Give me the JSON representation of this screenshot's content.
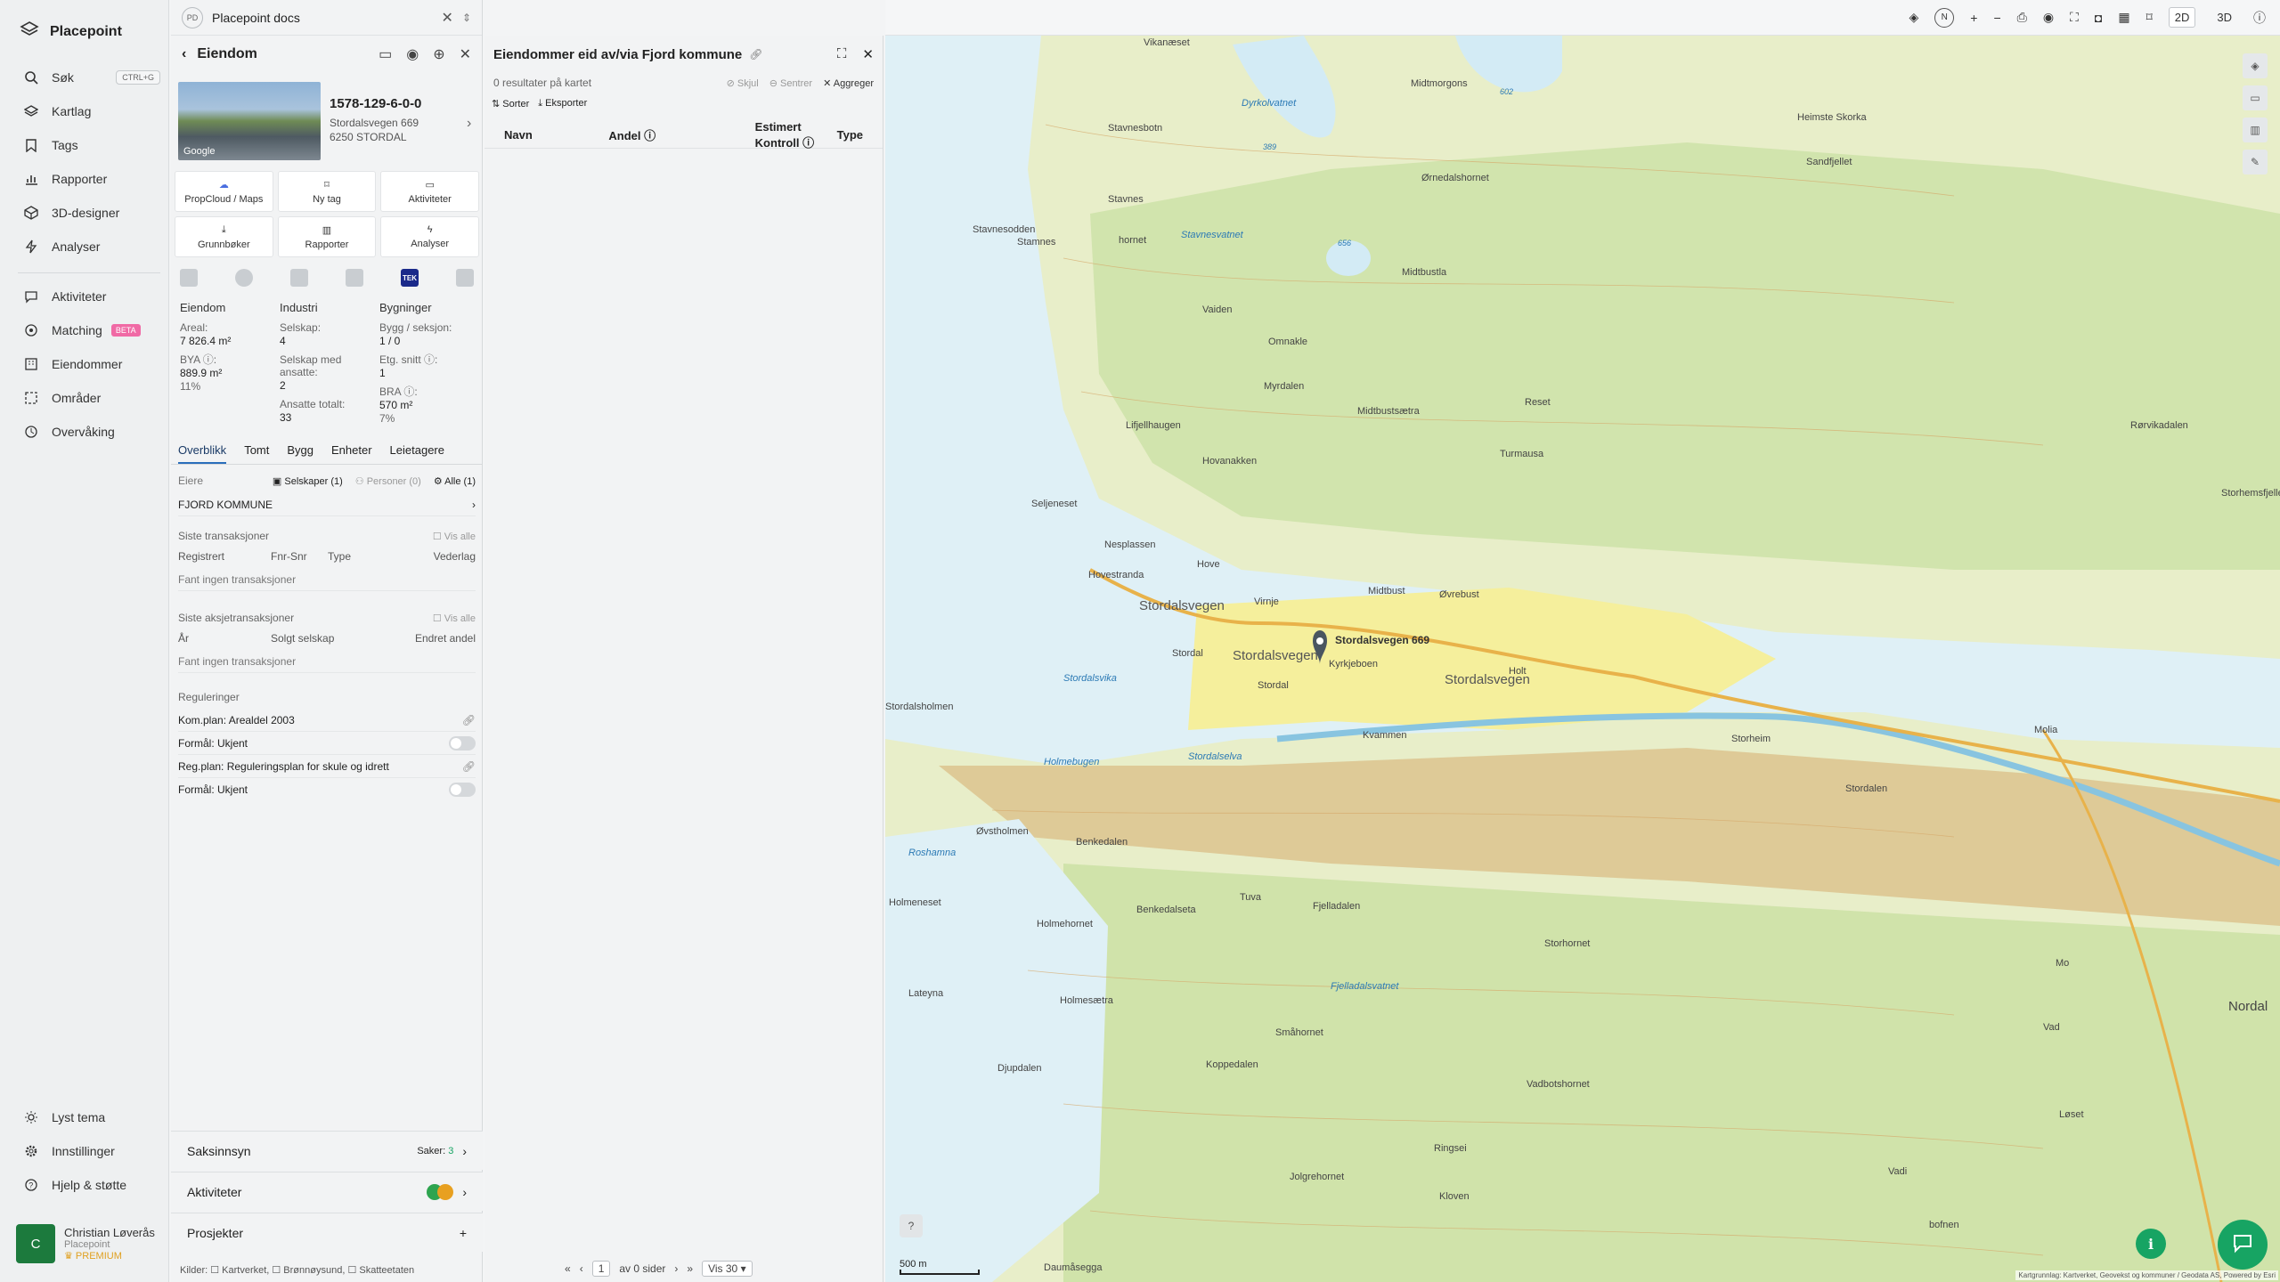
{
  "sidebar": {
    "brand": "Placepoint",
    "items": [
      {
        "label": "Søk",
        "icon": "search-icon",
        "kbd": "CTRL+G"
      },
      {
        "label": "Kartlag",
        "icon": "layers-icon"
      },
      {
        "label": "Tags",
        "icon": "bookmark-icon"
      },
      {
        "label": "Rapporter",
        "icon": "report-icon"
      },
      {
        "label": "3D-designer",
        "icon": "cube-icon"
      },
      {
        "label": "Analyser",
        "icon": "bolt-icon"
      },
      {
        "label": "Aktiviteter",
        "icon": "chat-icon"
      },
      {
        "label": "Matching",
        "icon": "target-icon",
        "badge": "BETA"
      },
      {
        "label": "Eiendommer",
        "icon": "building-icon"
      },
      {
        "label": "Områder",
        "icon": "area-icon"
      },
      {
        "label": "Overvåking",
        "icon": "monitor-icon"
      }
    ],
    "bottom": [
      {
        "label": "Lyst tema",
        "icon": "sun-icon"
      },
      {
        "label": "Innstillinger",
        "icon": "gear-icon"
      },
      {
        "label": "Hjelp & støtte",
        "icon": "help-icon"
      }
    ],
    "user": {
      "initial": "C",
      "name": "Christian Løverås",
      "org": "Placepoint",
      "tier": "PREMIUM"
    }
  },
  "property": {
    "workspace_badge": "PD",
    "workspace": "Placepoint docs",
    "header": "Eiendom",
    "id": "1578-129-6-0-0",
    "address1": "Stordalsvegen 669",
    "address2": "6250 STORDAL",
    "photo_credit": "Google",
    "buttons": [
      "PropCloud / Maps",
      "Ny tag",
      "Aktiviteter",
      "Grunnbøker",
      "Rapporter",
      "Analyser"
    ],
    "tek_logo": "TEK",
    "stats": {
      "eiendom": {
        "title": "Eiendom",
        "areal_label": "Areal:",
        "areal": "7 826.4 m²",
        "bya_label": "BYA ⓘ:",
        "bya": "889.9 m²",
        "bya_pct": "11%"
      },
      "industri": {
        "title": "Industri",
        "selskap_label": "Selskap:",
        "selskap": "4",
        "ansatte_label": "Selskap med ansatte:",
        "ansatte": "2",
        "total_label": "Ansatte totalt:",
        "total": "33"
      },
      "bygninger": {
        "title": "Bygninger",
        "bygg_label": "Bygg / seksjon:",
        "bygg": "1 / 0",
        "etg_label": "Etg. snitt ⓘ:",
        "etg": "1",
        "bra_label": "BRA ⓘ:",
        "bra": "570 m²",
        "bra_pct": "7%"
      }
    },
    "tabs": [
      "Overblikk",
      "Tomt",
      "Bygg",
      "Enheter",
      "Leietagere"
    ],
    "owners": {
      "label": "Eiere",
      "companies": "Selskaper (1)",
      "persons": "Personer (0)",
      "all": "Alle (1)",
      "owner": "FJORD KOMMUNE"
    },
    "transactions": {
      "title": "Siste transaksjoner",
      "show_all": "Vis alle",
      "cols": [
        "Registrert",
        "Fnr-Snr",
        "Type",
        "Vederlag"
      ],
      "empty": "Fant ingen transaksjoner"
    },
    "share_transactions": {
      "title": "Siste aksjetransaksjoner",
      "show_all": "Vis alle",
      "cols": [
        "År",
        "Solgt selskap",
        "Endret andel"
      ],
      "empty": "Fant ingen transaksjoner"
    },
    "regulations": {
      "title": "Reguleringer",
      "plan1": "Kom.plan: Arealdel 2003",
      "purpose1": "Formål: Ukjent",
      "plan2": "Reg.plan: Reguleringsplan for skule og idrett",
      "purpose2": "Formål: Ukjent"
    },
    "accordions": {
      "cases": "Saksinnsyn",
      "cases_count_label": "Saker:",
      "cases_count": "3",
      "activities": "Aktiviteter",
      "projects": "Prosjekter"
    },
    "sources": "Kilder:  ☐ Kartverket, ☐ Brønnøysund, ☐ Skatteetaten"
  },
  "list": {
    "title": "Eiendommer eid av/via Fjord kommune",
    "results": "0 resultater på kartet",
    "hide": "Skjul",
    "center": "Sentrer",
    "aggregate": "Aggreger",
    "sort": "Sorter",
    "export": "Eksporter",
    "columns": [
      "Navn",
      "Andel ⓘ",
      "Estimert Kontroll ⓘ",
      "Type"
    ],
    "pager": {
      "page": "1",
      "of": "av 0 sider",
      "show": "Vis 30"
    }
  },
  "map": {
    "modes": [
      "2D",
      "3D"
    ],
    "scale": "500 m",
    "attribution": "Kartgrunnlag: Kartverket, Geovekst og kommuner / Geodata AS, Powered by Esri",
    "pin_label": "Stordalsvegen 669",
    "labels": [
      {
        "t": "Stordalsvegen",
        "k": "road"
      },
      {
        "t": "Stordalsvegen",
        "k": "road"
      },
      {
        "t": "Stordalsvegen",
        "k": "road"
      },
      {
        "t": "Stordalsvika",
        "k": "water"
      },
      {
        "t": "Holmebugen",
        "k": "water"
      },
      {
        "t": "Roshamna",
        "k": "water"
      },
      {
        "t": "Stordalselva",
        "k": "water"
      },
      {
        "t": "Dyrkolvatnet",
        "k": "water"
      },
      {
        "t": "Stavnesvatnet",
        "k": "water"
      },
      {
        "t": "Fjelladalsvatnet",
        "k": "water"
      },
      {
        "t": "Stordal",
        "k": "place"
      },
      {
        "t": "Stordal",
        "k": "place"
      },
      {
        "t": "Kyrkjeboen",
        "k": "place"
      },
      {
        "t": "Kvammen",
        "k": "place"
      },
      {
        "t": "Holt",
        "k": "place"
      },
      {
        "t": "Storheim",
        "k": "place"
      },
      {
        "t": "Vikanæset",
        "k": "place"
      },
      {
        "t": "Stavnesbotn",
        "k": "place"
      },
      {
        "t": "Stavnes",
        "k": "place"
      },
      {
        "t": "hornet",
        "k": "place"
      },
      {
        "t": "Stavnesodden",
        "k": "place"
      },
      {
        "t": "Stamnes",
        "k": "place"
      },
      {
        "t": "Vaiden",
        "k": "place"
      },
      {
        "t": "Omnakle",
        "k": "place"
      },
      {
        "t": "Myrdalen",
        "k": "place"
      },
      {
        "t": "Lifjellhaugen",
        "k": "place"
      },
      {
        "t": "Hovanakken",
        "k": "place"
      },
      {
        "t": "Seljeneset",
        "k": "place"
      },
      {
        "t": "Nesplassen",
        "k": "place"
      },
      {
        "t": "Hovestranda",
        "k": "place"
      },
      {
        "t": "Hove",
        "k": "place"
      },
      {
        "t": "Virnje",
        "k": "place"
      },
      {
        "t": "Midtbust",
        "k": "place"
      },
      {
        "t": "Øvrebust",
        "k": "place"
      },
      {
        "t": "Midtbustsætra",
        "k": "place"
      },
      {
        "t": "Reset",
        "k": "place"
      },
      {
        "t": "Turmausa",
        "k": "place"
      },
      {
        "t": "Midtmorgons",
        "k": "place"
      },
      {
        "t": "Ørnedalshornet",
        "k": "place"
      },
      {
        "t": "Midtbustla",
        "k": "place"
      },
      {
        "t": "Heimste Skorka",
        "k": "place"
      },
      {
        "t": "Sandfjellet",
        "k": "place"
      },
      {
        "t": "Stordalsholmen",
        "k": "place"
      },
      {
        "t": "Øvstholmen",
        "k": "place"
      },
      {
        "t": "Benkedalen",
        "k": "place"
      },
      {
        "t": "Holmeneset",
        "k": "place"
      },
      {
        "t": "Holmehornet",
        "k": "place"
      },
      {
        "t": "Benkedalseta",
        "k": "place"
      },
      {
        "t": "Tuva",
        "k": "place"
      },
      {
        "t": "Fjelladalen",
        "k": "place"
      },
      {
        "t": "Lateyna",
        "k": "place"
      },
      {
        "t": "Holmesætra",
        "k": "place"
      },
      {
        "t": "Djupdalen",
        "k": "place"
      },
      {
        "t": "Koppedalen",
        "k": "place"
      },
      {
        "t": "Småhornet",
        "k": "place"
      },
      {
        "t": "Storhornet",
        "k": "place"
      },
      {
        "t": "Vadbotshornet",
        "k": "place"
      },
      {
        "t": "Ringsei",
        "k": "place"
      },
      {
        "t": "Jolgrehornet",
        "k": "place"
      },
      {
        "t": "Kloven",
        "k": "place"
      },
      {
        "t": "Daumåsegga",
        "k": "place"
      },
      {
        "t": "Mo",
        "k": "place"
      },
      {
        "t": "Vad",
        "k": "place"
      },
      {
        "t": "Løset",
        "k": "place"
      },
      {
        "t": "Molia",
        "k": "place"
      },
      {
        "t": "Stordalen",
        "k": "place"
      },
      {
        "t": "Storhemsfjellet",
        "k": "place"
      },
      {
        "t": "Nordal",
        "k": "place"
      },
      {
        "t": "Rørvikadalen",
        "k": "place"
      },
      {
        "t": "Vadi",
        "k": "place"
      },
      {
        "t": "bofnen",
        "k": "place"
      }
    ],
    "spot_heights": [
      "389",
      "602",
      "656"
    ]
  }
}
